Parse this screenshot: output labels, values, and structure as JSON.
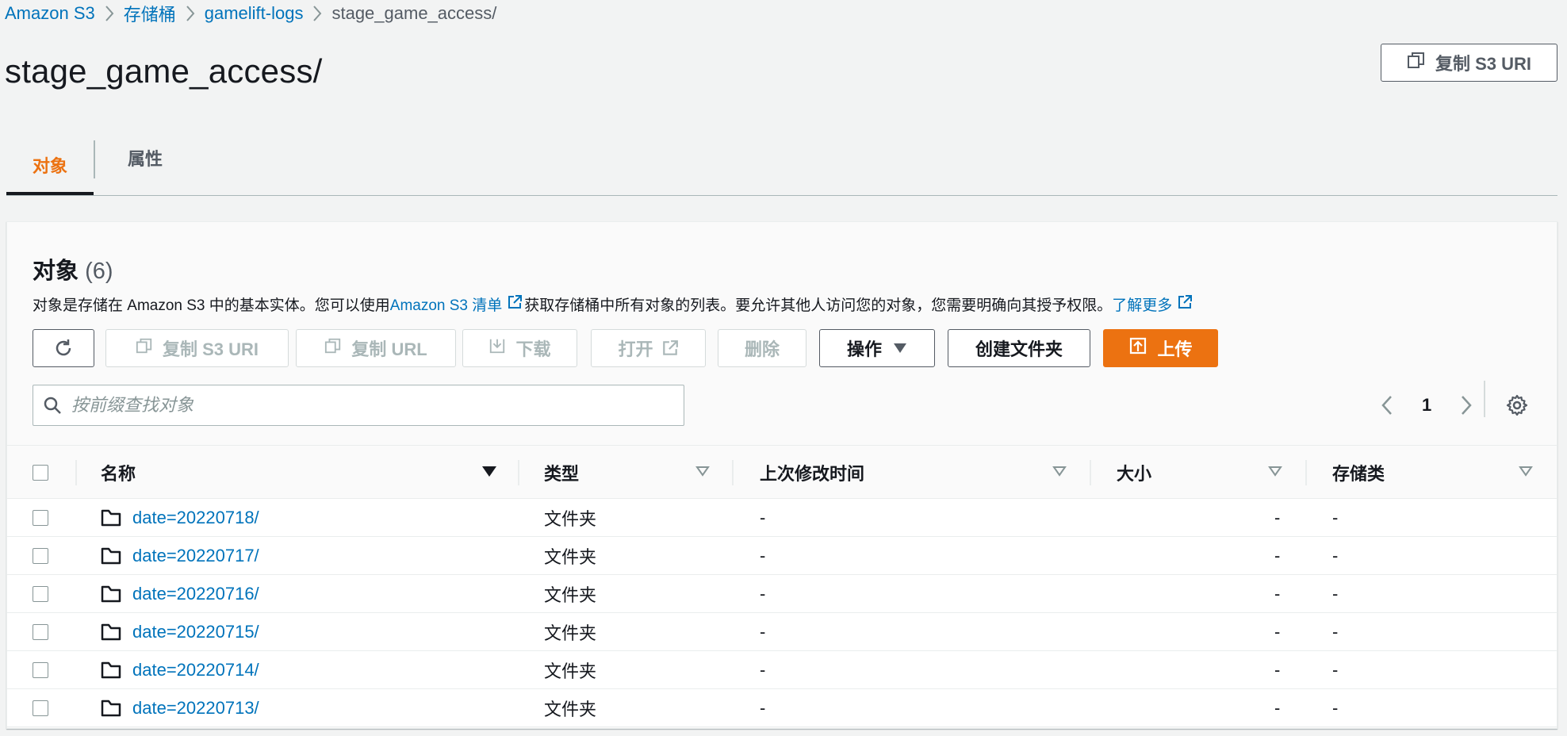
{
  "breadcrumb": {
    "items": [
      {
        "label": "Amazon S3"
      },
      {
        "label": "存储桶"
      },
      {
        "label": "gamelift-logs"
      }
    ],
    "current": "stage_game_access/"
  },
  "page": {
    "title": "stage_game_access/",
    "copy_s3_uri_label": "复制 S3 URI"
  },
  "tabs": [
    {
      "label": "对象",
      "active": true
    },
    {
      "label": "属性",
      "active": false
    }
  ],
  "panel": {
    "title": "对象",
    "count": "(6)",
    "description": {
      "part1": "对象是存储在 Amazon S3 中的基本实体。您可以使用 ",
      "link1": "Amazon S3 清单",
      "part2": "获取存储桶中所有对象的列表。要允许其他人访问您的对象，您需要明确向其授予权限。",
      "link2": "了解更多"
    }
  },
  "toolbar": {
    "refresh_icon": "refresh-icon",
    "copy_s3_uri": "复制 S3 URI",
    "copy_url": "复制 URL",
    "download": "下载",
    "open": "打开",
    "delete": "删除",
    "actions": "操作",
    "create_folder": "创建文件夹",
    "upload": "上传"
  },
  "search": {
    "placeholder": "按前缀查找对象",
    "value": ""
  },
  "pagination": {
    "current_page": "1"
  },
  "table": {
    "columns": [
      "名称",
      "类型",
      "上次修改时间",
      "大小",
      "存储类"
    ],
    "rows": [
      {
        "name": "date=20220718/",
        "type": "文件夹",
        "modified": "-",
        "size": "-",
        "storage": "-"
      },
      {
        "name": "date=20220717/",
        "type": "文件夹",
        "modified": "-",
        "size": "-",
        "storage": "-"
      },
      {
        "name": "date=20220716/",
        "type": "文件夹",
        "modified": "-",
        "size": "-",
        "storage": "-"
      },
      {
        "name": "date=20220715/",
        "type": "文件夹",
        "modified": "-",
        "size": "-",
        "storage": "-"
      },
      {
        "name": "date=20220714/",
        "type": "文件夹",
        "modified": "-",
        "size": "-",
        "storage": "-"
      },
      {
        "name": "date=20220713/",
        "type": "文件夹",
        "modified": "-",
        "size": "-",
        "storage": "-"
      }
    ]
  },
  "colors": {
    "link": "#0073bb",
    "accent": "#ec7211",
    "text": "#16191f",
    "muted": "#545b64",
    "disabled": "#aab7b8"
  }
}
